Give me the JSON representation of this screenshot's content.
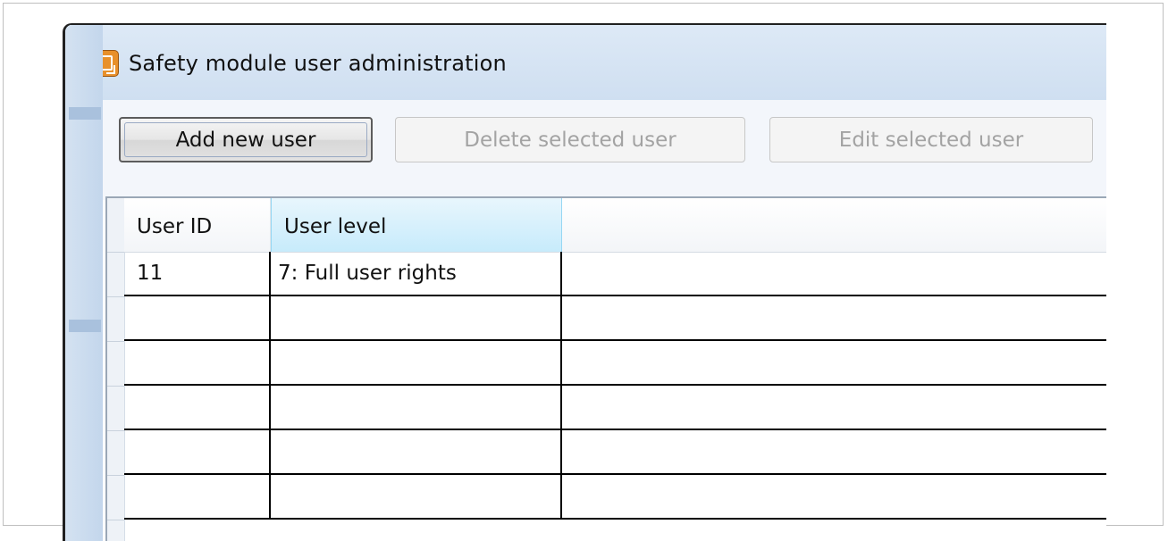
{
  "window": {
    "title": "Safety module user administration",
    "icon": "app-window-icon"
  },
  "toolbar": {
    "add_label": "Add new user",
    "delete_label": "Delete selected user",
    "edit_label": "Edit selected user"
  },
  "table": {
    "columns": [
      "User ID",
      "User level"
    ],
    "rows": [
      [
        "11",
        "7: Full user rights"
      ],
      [
        "",
        ""
      ],
      [
        "",
        ""
      ],
      [
        "",
        ""
      ],
      [
        "",
        ""
      ],
      [
        "",
        ""
      ]
    ]
  },
  "colors": {
    "titlebar": "#d6e4f4",
    "selected_header": "#c7ebfb",
    "icon_accent": "#e8902b"
  }
}
